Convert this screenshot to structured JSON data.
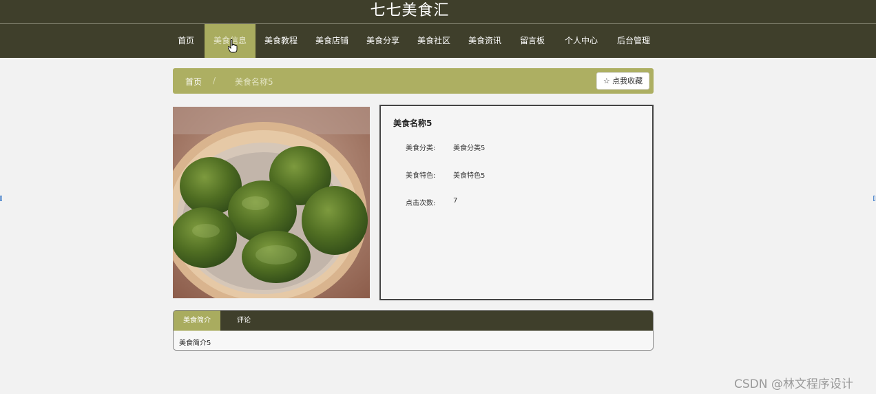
{
  "site": {
    "title": "七七美食汇"
  },
  "nav": {
    "items": [
      {
        "label": "首页"
      },
      {
        "label": "美食信息"
      },
      {
        "label": "美食教程"
      },
      {
        "label": "美食店铺"
      },
      {
        "label": "美食分享"
      },
      {
        "label": "美食社区"
      },
      {
        "label": "美食资讯"
      },
      {
        "label": "留言板"
      },
      {
        "label": "个人中心"
      },
      {
        "label": "后台管理"
      }
    ],
    "active": "美食信息"
  },
  "breadcrumb": {
    "home": "首页",
    "separator": "/",
    "current": "美食名称5"
  },
  "favorite_button": {
    "icon": "star-outline-icon",
    "label": "☆ 点我收藏"
  },
  "detail": {
    "name": "美食名称5",
    "fields": [
      {
        "label": "美食分类:",
        "value": "美食分类5"
      },
      {
        "label": "美食特色:",
        "value": "美食特色5"
      },
      {
        "label": "点击次数:",
        "value": "7"
      }
    ]
  },
  "tabs": {
    "items": [
      {
        "label": "美食简介"
      },
      {
        "label": "评论"
      }
    ],
    "active": "美食简介",
    "content": "美食简介5"
  },
  "watermark": "CSDN @林文程序设计",
  "colors": {
    "header_bg": "#3f3f2b",
    "accent": "#a9ac5f",
    "breadcrumb_bg": "#adaf62"
  }
}
